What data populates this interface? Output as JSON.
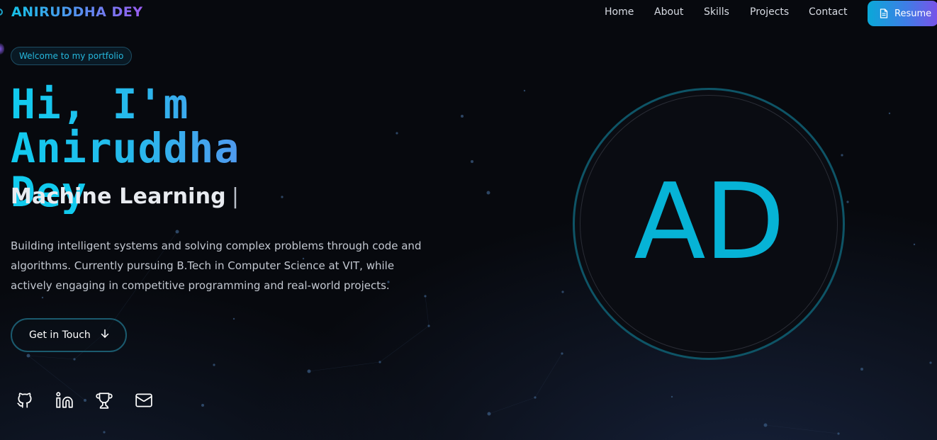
{
  "header": {
    "logo": "ANIRUDDHA DEY",
    "nav": [
      {
        "label": "Home"
      },
      {
        "label": "About"
      },
      {
        "label": "Skills"
      },
      {
        "label": "Projects"
      },
      {
        "label": "Contact"
      }
    ],
    "resume_label": "Resume",
    "resume_icon": "document-icon"
  },
  "hero": {
    "badge": "Welcome to my portfolio",
    "title_line1": "Hi, I'm Aniruddha",
    "title_line2": "Dey",
    "role": "Machine Learning",
    "role_cursor": "|",
    "bio": "Building intelligent systems and solving complex problems through code and algorithms. Currently pursuing B.Tech in Computer Science at VIT, while actively engaging in competitive programming and real-world projects.",
    "cta_label": "Get in Touch",
    "cta_icon": "arrow-down-icon",
    "socials": [
      {
        "icon": "github-icon"
      },
      {
        "icon": "linkedin-icon"
      },
      {
        "icon": "trophy-icon"
      },
      {
        "icon": "mail-icon"
      }
    ]
  },
  "avatar": {
    "initials": "AD"
  },
  "colors": {
    "accent_cyan": "#10cbee",
    "accent_purple": "#9b5cf0",
    "background": "#07090e"
  }
}
